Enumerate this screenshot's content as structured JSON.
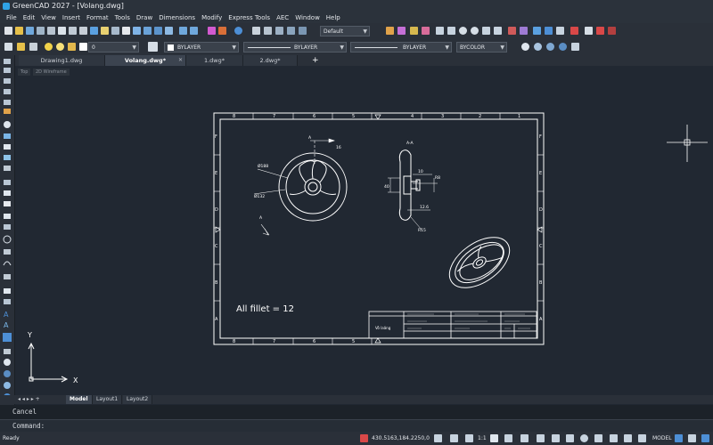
{
  "window": {
    "title": "GreenCAD 2027 - [Volang.dwg]"
  },
  "menu": [
    "File",
    "Edit",
    "View",
    "Insert",
    "Format",
    "Tools",
    "Draw",
    "Dimensions",
    "Modify",
    "Express Tools",
    "AEC",
    "Window",
    "Help"
  ],
  "toolbar": {
    "text_style": "Default",
    "layer": "0",
    "color": "BYLAYER",
    "linetype": "BYLAYER",
    "lineweight": "BYLAYER",
    "plotstyle": "BYCOLOR"
  },
  "tabs": [
    {
      "label": "Drawing1.dwg"
    },
    {
      "label": "Volang.dwg*"
    },
    {
      "label": "1.dwg*"
    },
    {
      "label": "2.dwg*"
    }
  ],
  "tab_plus": "+",
  "viewport": {
    "view_label": "Top",
    "style_label": "2D Wireframe"
  },
  "drawing": {
    "border_top_numbers": [
      "8",
      "7",
      "6",
      "5",
      "4",
      "3",
      "2",
      "1"
    ],
    "border_side_letters": [
      "F",
      "E",
      "D",
      "C",
      "B",
      "A"
    ],
    "section_label": "A-A",
    "section_mark": "A",
    "dimensions": {
      "d1": "Ø188",
      "d2": "Ø132",
      "d3": "16",
      "d4": "10",
      "d5": "R8",
      "d6": "12.6",
      "d7": "R15",
      "d8": "40"
    },
    "note": "All fillet = 12",
    "title_block_name": "Vô laăng"
  },
  "ucs": {
    "y": "Y",
    "x": "X"
  },
  "layout_tabs": [
    "Model",
    "Layout1",
    "Layout2"
  ],
  "command": {
    "history": "Cancel",
    "prompt": "Command:"
  },
  "status": {
    "ready": "Ready",
    "coords": "430.5163,184.2250,0",
    "scale": "1:1",
    "model": "MODEL"
  }
}
